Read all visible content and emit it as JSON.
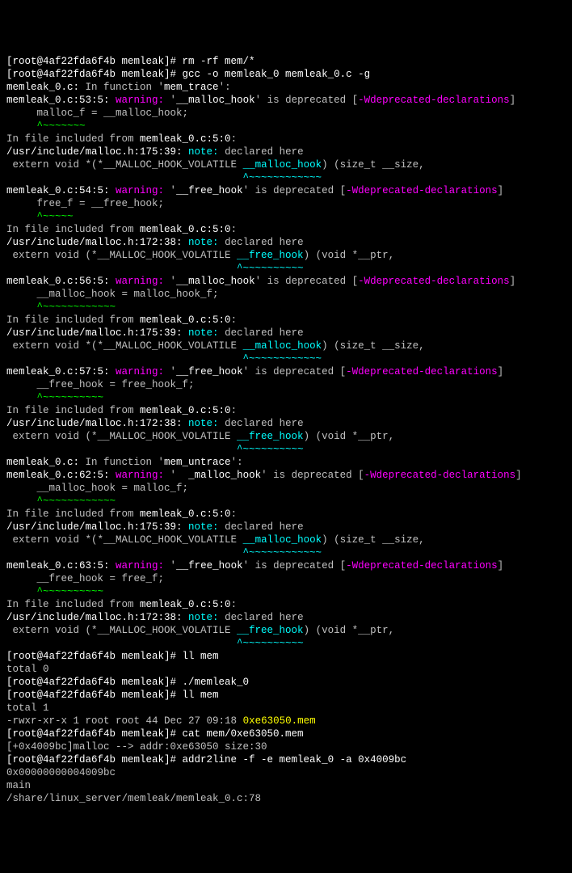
{
  "prompt_head": "[root@4af22fda6f4b memleak]# ",
  "lines": [
    {
      "seg": [
        {
          "c": "w",
          "t": "[root@4af22fda6f4b memleak]# rm -rf mem/*"
        }
      ]
    },
    {
      "seg": [
        {
          "c": "w",
          "t": "[root@4af22fda6f4b memleak]# gcc -o memleak_0 memleak_0.c -g"
        }
      ]
    },
    {
      "seg": [
        {
          "c": "w",
          "t": "memleak_0.c:"
        },
        {
          "c": "g",
          "t": " In function '"
        },
        {
          "c": "w",
          "t": "mem_trace"
        },
        {
          "c": "g",
          "t": "':"
        }
      ]
    },
    {
      "seg": [
        {
          "c": "w",
          "t": "memleak_0.c:53:5:"
        },
        {
          "c": "mg",
          "t": " warning: "
        },
        {
          "c": "g",
          "t": "'"
        },
        {
          "c": "w",
          "t": "__malloc_hook"
        },
        {
          "c": "g",
          "t": "' is deprecated ["
        },
        {
          "c": "mg",
          "t": "-Wdeprecated-declarations"
        },
        {
          "c": "g",
          "t": "]"
        }
      ]
    },
    {
      "seg": [
        {
          "c": "g",
          "t": "     malloc_f = __malloc_hook;"
        }
      ]
    },
    {
      "seg": [
        {
          "c": "gr",
          "t": "     ^~~~~~~~"
        }
      ]
    },
    {
      "seg": [
        {
          "c": "g",
          "t": "In file included from "
        },
        {
          "c": "w",
          "t": "memleak_0.c:5:0"
        },
        {
          "c": "g",
          "t": ":"
        }
      ]
    },
    {
      "seg": [
        {
          "c": "w",
          "t": "/usr/include/malloc.h:175:39:"
        },
        {
          "c": "cy",
          "t": " note: "
        },
        {
          "c": "g",
          "t": "declared here"
        }
      ]
    },
    {
      "seg": [
        {
          "c": "g",
          "t": " extern void *(*__MALLOC_HOOK_VOLATILE "
        },
        {
          "c": "cy",
          "t": "__malloc_hook"
        },
        {
          "c": "g",
          "t": ") (size_t __size,"
        }
      ]
    },
    {
      "seg": [
        {
          "c": "cy",
          "t": "                                       ^~~~~~~~~~~~~"
        }
      ]
    },
    {
      "seg": [
        {
          "c": "w",
          "t": "memleak_0.c:54:5:"
        },
        {
          "c": "mg",
          "t": " warning: "
        },
        {
          "c": "g",
          "t": "'"
        },
        {
          "c": "w",
          "t": "__free_hook"
        },
        {
          "c": "g",
          "t": "' is deprecated ["
        },
        {
          "c": "mg",
          "t": "-Wdeprecated-declarations"
        },
        {
          "c": "g",
          "t": "]"
        }
      ]
    },
    {
      "seg": [
        {
          "c": "g",
          "t": "     free_f = __free_hook;"
        }
      ]
    },
    {
      "seg": [
        {
          "c": "gr",
          "t": "     ^~~~~~"
        }
      ]
    },
    {
      "seg": [
        {
          "c": "g",
          "t": "In file included from "
        },
        {
          "c": "w",
          "t": "memleak_0.c:5:0"
        },
        {
          "c": "g",
          "t": ":"
        }
      ]
    },
    {
      "seg": [
        {
          "c": "w",
          "t": "/usr/include/malloc.h:172:38:"
        },
        {
          "c": "cy",
          "t": " note: "
        },
        {
          "c": "g",
          "t": "declared here"
        }
      ]
    },
    {
      "seg": [
        {
          "c": "g",
          "t": " extern void (*__MALLOC_HOOK_VOLATILE "
        },
        {
          "c": "cy",
          "t": "__free_hook"
        },
        {
          "c": "g",
          "t": ") (void *__ptr,"
        }
      ]
    },
    {
      "seg": [
        {
          "c": "cy",
          "t": "                                      ^~~~~~~~~~~"
        }
      ]
    },
    {
      "seg": [
        {
          "c": "w",
          "t": "memleak_0.c:56:5:"
        },
        {
          "c": "mg",
          "t": " warning: "
        },
        {
          "c": "g",
          "t": "'"
        },
        {
          "c": "w",
          "t": "__malloc_hook"
        },
        {
          "c": "g",
          "t": "' is deprecated ["
        },
        {
          "c": "mg",
          "t": "-Wdeprecated-declarations"
        },
        {
          "c": "g",
          "t": "]"
        }
      ]
    },
    {
      "seg": [
        {
          "c": "g",
          "t": "     __malloc_hook = malloc_hook_f;"
        }
      ]
    },
    {
      "seg": [
        {
          "c": "gr",
          "t": "     ^~~~~~~~~~~~~"
        }
      ]
    },
    {
      "seg": [
        {
          "c": "g",
          "t": "In file included from "
        },
        {
          "c": "w",
          "t": "memleak_0.c:5:0"
        },
        {
          "c": "g",
          "t": ":"
        }
      ]
    },
    {
      "seg": [
        {
          "c": "w",
          "t": "/usr/include/malloc.h:175:39:"
        },
        {
          "c": "cy",
          "t": " note: "
        },
        {
          "c": "g",
          "t": "declared here"
        }
      ]
    },
    {
      "seg": [
        {
          "c": "g",
          "t": " extern void *(*__MALLOC_HOOK_VOLATILE "
        },
        {
          "c": "cy",
          "t": "__malloc_hook"
        },
        {
          "c": "g",
          "t": ") (size_t __size,"
        }
      ]
    },
    {
      "seg": [
        {
          "c": "cy",
          "t": "                                       ^~~~~~~~~~~~~"
        }
      ]
    },
    {
      "seg": [
        {
          "c": "w",
          "t": "memleak_0.c:57:5:"
        },
        {
          "c": "mg",
          "t": " warning: "
        },
        {
          "c": "g",
          "t": "'"
        },
        {
          "c": "w",
          "t": "__free_hook"
        },
        {
          "c": "g",
          "t": "' is deprecated ["
        },
        {
          "c": "mg",
          "t": "-Wdeprecated-declarations"
        },
        {
          "c": "g",
          "t": "]"
        }
      ]
    },
    {
      "seg": [
        {
          "c": "g",
          "t": "     __free_hook = free_hook_f;"
        }
      ]
    },
    {
      "seg": [
        {
          "c": "gr",
          "t": "     ^~~~~~~~~~~"
        }
      ]
    },
    {
      "seg": [
        {
          "c": "g",
          "t": "In file included from "
        },
        {
          "c": "w",
          "t": "memleak_0.c:5:0"
        },
        {
          "c": "g",
          "t": ":"
        }
      ]
    },
    {
      "seg": [
        {
          "c": "w",
          "t": "/usr/include/malloc.h:172:38:"
        },
        {
          "c": "cy",
          "t": " note: "
        },
        {
          "c": "g",
          "t": "declared here"
        }
      ]
    },
    {
      "seg": [
        {
          "c": "g",
          "t": " extern void (*__MALLOC_HOOK_VOLATILE "
        },
        {
          "c": "cy",
          "t": "__free_hook"
        },
        {
          "c": "g",
          "t": ") (void *__ptr,"
        }
      ]
    },
    {
      "seg": [
        {
          "c": "cy",
          "t": "                                      ^~~~~~~~~~~"
        }
      ]
    },
    {
      "seg": [
        {
          "c": "w",
          "t": "memleak_0.c:"
        },
        {
          "c": "g",
          "t": " In function '"
        },
        {
          "c": "w",
          "t": "mem_untrace"
        },
        {
          "c": "g",
          "t": "':"
        }
      ]
    },
    {
      "seg": [
        {
          "c": "w",
          "t": "memleak_0.c:62:5:"
        },
        {
          "c": "mg",
          "t": " warning: "
        },
        {
          "c": "g",
          "t": "'  "
        },
        {
          "c": "w",
          "t": "_malloc_hook"
        },
        {
          "c": "g",
          "t": "' is deprecated ["
        },
        {
          "c": "mg",
          "t": "-Wdeprecated-declarations"
        },
        {
          "c": "g",
          "t": "]"
        }
      ]
    },
    {
      "seg": [
        {
          "c": "g",
          "t": "     __malloc_hook = malloc_f;"
        }
      ]
    },
    {
      "seg": [
        {
          "c": "gr",
          "t": "     ^~~~~~~~~~~~~"
        }
      ]
    },
    {
      "seg": [
        {
          "c": "g",
          "t": "In file included from "
        },
        {
          "c": "w",
          "t": "memleak_0.c:5:0"
        },
        {
          "c": "g",
          "t": ":"
        }
      ]
    },
    {
      "seg": [
        {
          "c": "w",
          "t": "/usr/include/malloc.h:175:39:"
        },
        {
          "c": "cy",
          "t": " note: "
        },
        {
          "c": "g",
          "t": "declared here"
        }
      ]
    },
    {
      "seg": [
        {
          "c": "g",
          "t": " extern void *(*__MALLOC_HOOK_VOLATILE "
        },
        {
          "c": "cy",
          "t": "__malloc_hook"
        },
        {
          "c": "g",
          "t": ") (size_t __size,"
        }
      ]
    },
    {
      "seg": [
        {
          "c": "cy",
          "t": "                                       ^~~~~~~~~~~~~"
        }
      ]
    },
    {
      "seg": [
        {
          "c": "w",
          "t": "memleak_0.c:63:5:"
        },
        {
          "c": "mg",
          "t": " warning: "
        },
        {
          "c": "g",
          "t": "'"
        },
        {
          "c": "w",
          "t": "__free_hook"
        },
        {
          "c": "g",
          "t": "' is deprecated ["
        },
        {
          "c": "mg",
          "t": "-Wdeprecated-declarations"
        },
        {
          "c": "g",
          "t": "]"
        }
      ]
    },
    {
      "seg": [
        {
          "c": "g",
          "t": "     __free_hook = free_f;"
        }
      ]
    },
    {
      "seg": [
        {
          "c": "gr",
          "t": "     ^~~~~~~~~~~"
        }
      ]
    },
    {
      "seg": [
        {
          "c": "g",
          "t": "In file included from "
        },
        {
          "c": "w",
          "t": "memleak_0.c:5:0"
        },
        {
          "c": "g",
          "t": ":"
        }
      ]
    },
    {
      "seg": [
        {
          "c": "w",
          "t": "/usr/include/malloc.h:172:38:"
        },
        {
          "c": "cy",
          "t": " note: "
        },
        {
          "c": "g",
          "t": "declared here"
        }
      ]
    },
    {
      "seg": [
        {
          "c": "g",
          "t": " extern void (*__MALLOC_HOOK_VOLATILE "
        },
        {
          "c": "cy",
          "t": "__free_hook"
        },
        {
          "c": "g",
          "t": ") (void *__ptr,"
        }
      ]
    },
    {
      "seg": [
        {
          "c": "cy",
          "t": "                                      ^~~~~~~~~~~"
        }
      ]
    },
    {
      "seg": [
        {
          "c": "w",
          "t": "[root@4af22fda6f4b memleak]# ll mem"
        }
      ]
    },
    {
      "seg": [
        {
          "c": "g",
          "t": "total 0"
        }
      ]
    },
    {
      "seg": [
        {
          "c": "w",
          "t": "[root@4af22fda6f4b memleak]# ./memleak_0"
        }
      ]
    },
    {
      "seg": [
        {
          "c": "w",
          "t": "[root@4af22fda6f4b memleak]# ll mem"
        }
      ]
    },
    {
      "seg": [
        {
          "c": "g",
          "t": "total 1"
        }
      ]
    },
    {
      "seg": [
        {
          "c": "g",
          "t": "-rwxr-xr-x 1 root root 44 Dec 27 09:18 "
        },
        {
          "c": "ye",
          "t": "0xe63050.mem"
        }
      ]
    },
    {
      "seg": [
        {
          "c": "w",
          "t": "[root@4af22fda6f4b memleak]# cat mem/0xe63050.mem"
        }
      ]
    },
    {
      "seg": [
        {
          "c": "g",
          "t": "[+0x4009bc]malloc --> addr:0xe63050 size:30"
        }
      ]
    },
    {
      "seg": [
        {
          "c": "w",
          "t": "[root@4af22fda6f4b memleak]# addr2line -f -e memleak_0 -a 0x4009bc"
        }
      ]
    },
    {
      "seg": [
        {
          "c": "g",
          "t": "0x00000000004009bc"
        }
      ]
    },
    {
      "seg": [
        {
          "c": "g",
          "t": "main"
        }
      ]
    },
    {
      "seg": [
        {
          "c": "g",
          "t": "/share/linux_server/memleak/memleak_0.c:78"
        }
      ]
    }
  ]
}
